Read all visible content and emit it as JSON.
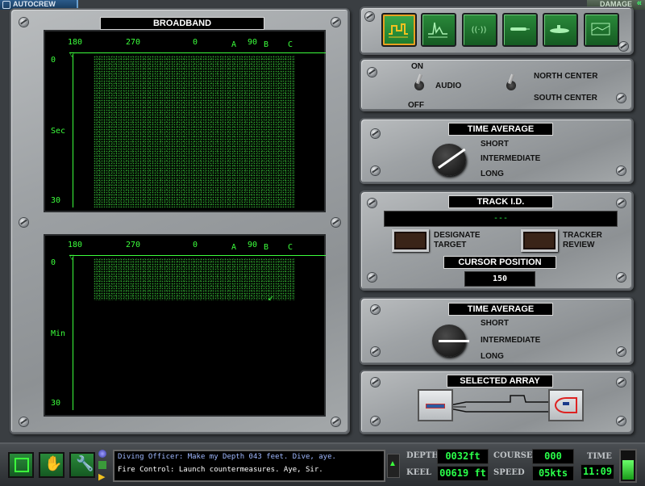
{
  "topbar": {
    "autocrew_label": "AUTOCREW",
    "damage_label": "DAMAGE"
  },
  "broadband": {
    "title": "BROADBAND",
    "bearing_labels": [
      "180",
      "270",
      "0",
      "A",
      "90",
      "B",
      "C"
    ],
    "top_scope": {
      "y_top": "0",
      "y_unit": "Sec",
      "y_bottom": "30"
    },
    "bottom_scope": {
      "y_top": "0",
      "y_unit": "Min",
      "y_bottom": "30"
    }
  },
  "station_buttons": [
    {
      "name": "broadband-station",
      "active": true
    },
    {
      "name": "narrowband-station",
      "active": false
    },
    {
      "name": "active-sonar-station",
      "active": false
    },
    {
      "name": "weapons-station",
      "active": false
    },
    {
      "name": "periscope-station",
      "active": false
    },
    {
      "name": "tactical-station",
      "active": false
    }
  ],
  "audio": {
    "on_label": "ON",
    "off_label": "OFF",
    "audio_label": "AUDIO",
    "north_label": "NORTH CENTER",
    "south_label": "SOUTH CENTER"
  },
  "time_average_1": {
    "title": "TIME AVERAGE",
    "options": [
      "SHORT",
      "INTERMEDIATE",
      "LONG"
    ]
  },
  "track": {
    "title": "TRACK I.D.",
    "value": "---",
    "designate_label": "DESIGNATE TARGET",
    "tracker_label": "TRACKER REVIEW",
    "cursor_title": "CURSOR POSITION",
    "cursor_value": "150"
  },
  "time_average_2": {
    "title": "TIME AVERAGE",
    "options": [
      "SHORT",
      "INTERMEDIATE",
      "LONG"
    ]
  },
  "selected_array": {
    "title": "SELECTED ARRAY"
  },
  "messages": [
    "Diving Officer: Make my Depth 043 feet. Dive, aye.",
    "Fire Control: Launch countermeasures. Aye, Sir."
  ],
  "status": {
    "depth_label": "DEPTH",
    "depth_value": "0032ft",
    "course_label": "COURSE",
    "course_value": "000",
    "keel_label": "KEEL",
    "keel_value": "00619 ft",
    "speed_label": "SPEED",
    "speed_value": "05kts",
    "time_label": "TIME",
    "time_value": "11:09"
  },
  "colors": {
    "scope_green": "#3cff3c",
    "message_blue": "#9fb8ff",
    "readout_green": "#2aff4a"
  }
}
